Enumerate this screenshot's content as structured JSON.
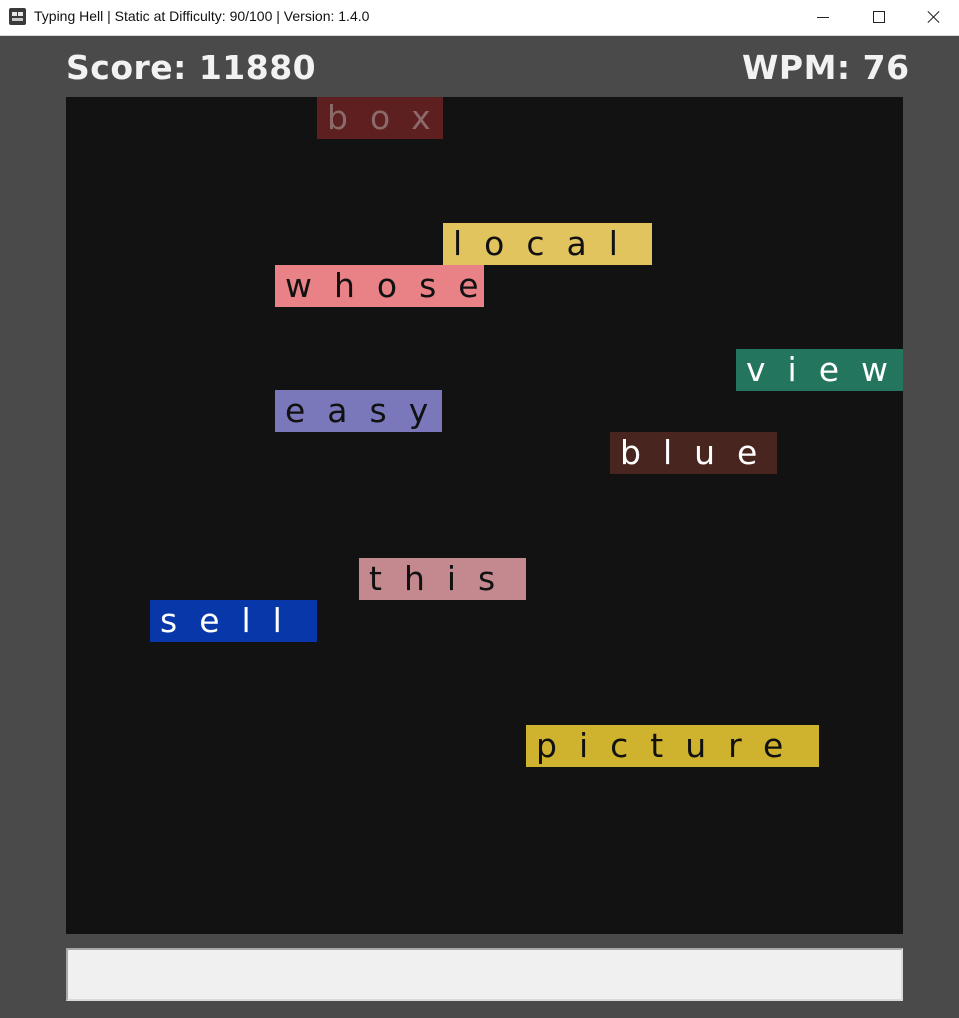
{
  "window": {
    "title": "Typing Hell | Static at Difficulty: 90/100 | Version: 1.4.0",
    "icon": "game-face-icon",
    "controls": [
      "minimize-icon",
      "maximize-icon",
      "close-icon"
    ]
  },
  "hud": {
    "score_text": "Score: 11880",
    "wpm_text": "WPM: 76"
  },
  "words": [
    {
      "text": "box",
      "bg": "#5e1f21",
      "fg": "#8a6a6a"
    },
    {
      "text": "local",
      "bg": "#e2c45f",
      "fg": "#111111"
    },
    {
      "text": "whose",
      "bg": "#e88286",
      "fg": "#111111"
    },
    {
      "text": "view",
      "bg": "#23765d",
      "fg": "#ffffff"
    },
    {
      "text": "easy",
      "bg": "#7a78bb",
      "fg": "#111111"
    },
    {
      "text": "blue",
      "bg": "#48261f",
      "fg": "#ffffff"
    },
    {
      "text": "this",
      "bg": "#c3898f",
      "fg": "#111111"
    },
    {
      "text": "sell",
      "bg": "#0737a8",
      "fg": "#ffffff"
    },
    {
      "text": "picture",
      "bg": "#cfb32f",
      "fg": "#111111"
    }
  ],
  "input": {
    "value": "",
    "placeholder": ""
  }
}
